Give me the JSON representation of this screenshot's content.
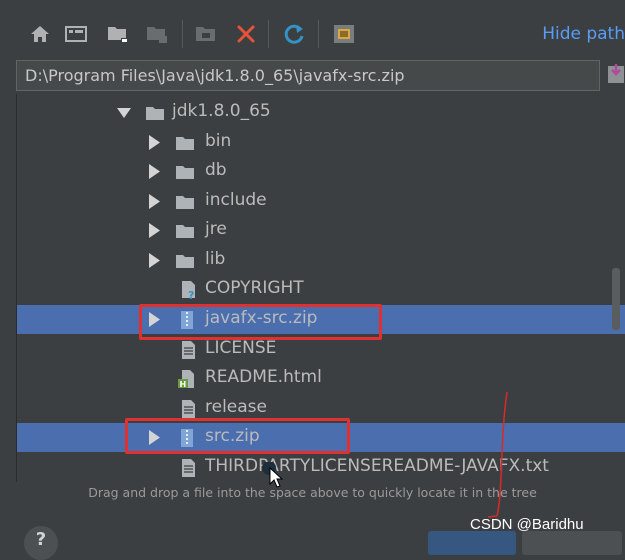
{
  "toolbar": {
    "buttons": [
      {
        "name": "home-icon"
      },
      {
        "name": "desktop-icon"
      },
      {
        "name": "new-folder-icon"
      },
      {
        "name": "module-folder-icon"
      },
      {
        "name": "project-folder-icon"
      },
      {
        "name": "delete-icon"
      },
      {
        "name": "refresh-icon"
      },
      {
        "name": "show-hidden-icon"
      }
    ],
    "hide_path_label": "Hide path"
  },
  "path_field": {
    "value": "D:\\Program Files\\Java\\jdk1.8.0_65\\javafx-src.zip"
  },
  "tree": {
    "rows": [
      {
        "label": "jdk1.8.0_65",
        "type": "folder",
        "expanded": true,
        "selected": false
      },
      {
        "label": "bin",
        "type": "folder",
        "expanded": false,
        "selected": false
      },
      {
        "label": "db",
        "type": "folder",
        "expanded": false,
        "selected": false
      },
      {
        "label": "include",
        "type": "folder",
        "expanded": false,
        "selected": false
      },
      {
        "label": "jre",
        "type": "folder",
        "expanded": false,
        "selected": false
      },
      {
        "label": "lib",
        "type": "folder",
        "expanded": false,
        "selected": false
      },
      {
        "label": "COPYRIGHT",
        "type": "file-unknown",
        "selected": false
      },
      {
        "label": "javafx-src.zip",
        "type": "archive",
        "expanded": false,
        "selected": true
      },
      {
        "label": "LICENSE",
        "type": "file-text",
        "selected": false
      },
      {
        "label": "README.html",
        "type": "file-html",
        "selected": false
      },
      {
        "label": "release",
        "type": "file-text",
        "selected": false
      },
      {
        "label": "src.zip",
        "type": "archive",
        "expanded": false,
        "selected": true
      },
      {
        "label": "THIRDPARTYLICENSEREADME-JAVAFX.txt",
        "type": "file-text",
        "selected": false
      }
    ]
  },
  "hint_text": "Drag and drop a file into the space above to quickly locate it in the tree",
  "help_label": "?",
  "watermark": "CSDN @Baridhu",
  "colors": {
    "background": "#3c3f41",
    "selection": "#4b6eaf",
    "highlight_box": "#e03030",
    "link": "#589df6"
  }
}
